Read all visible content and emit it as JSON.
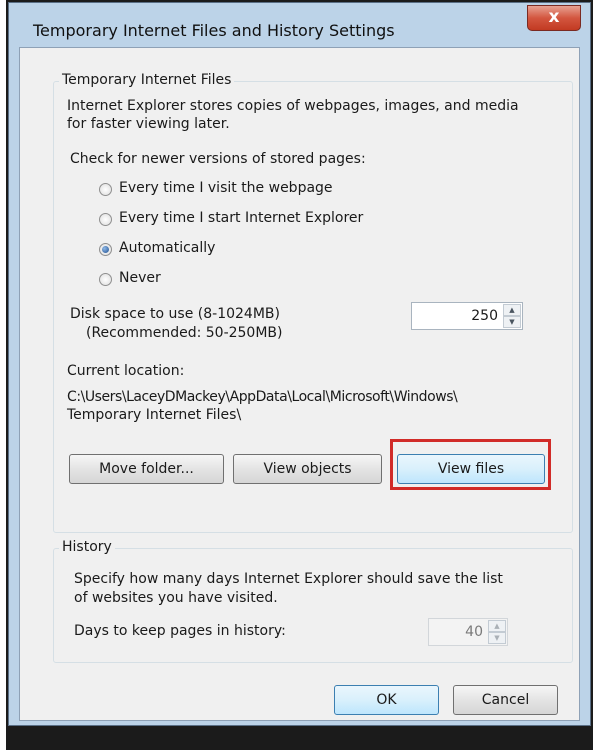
{
  "dialog": {
    "title": "Temporary Internet Files and History Settings",
    "close_glyph": "x"
  },
  "temp_files": {
    "group_title": "Temporary Internet Files",
    "description_line1": "Internet Explorer stores copies of webpages, images, and media",
    "description_line2": "for faster viewing later.",
    "check_label": "Check for newer versions of stored pages:",
    "options": [
      {
        "label": "Every time I visit the webpage",
        "checked": false
      },
      {
        "label": "Every time I start Internet Explorer",
        "checked": false
      },
      {
        "label": "Automatically",
        "checked": true
      },
      {
        "label": "Never",
        "checked": false
      }
    ],
    "disk_label_line1": "Disk space to use (8-1024MB)",
    "disk_label_line2": "(Recommended: 50-250MB)",
    "disk_value": "250",
    "location_label": "Current location:",
    "location_line1": "C:\\Users\\LaceyDMackey\\AppData\\Local\\Microsoft\\Windows\\",
    "location_line2": "Temporary Internet Files\\",
    "buttons": {
      "move_folder": "Move folder...",
      "view_objects": "View objects",
      "view_files": "View files"
    }
  },
  "history": {
    "group_title": "History",
    "description_line1": "Specify how many days Internet Explorer should save the list",
    "description_line2": "of websites you have visited.",
    "days_label": "Days to keep pages in history:",
    "days_value": "40"
  },
  "footer": {
    "ok": "OK",
    "cancel": "Cancel"
  },
  "colors": {
    "highlight": "#d12b28",
    "window_frame": "#bcd3e8"
  }
}
